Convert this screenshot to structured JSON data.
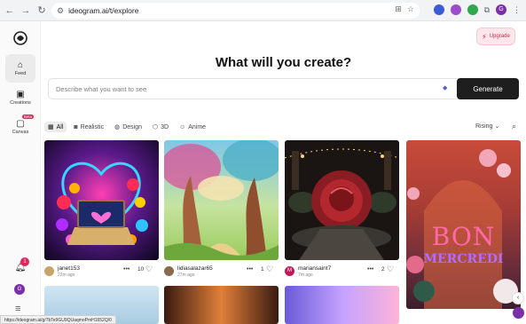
{
  "browser": {
    "url": "ideogram.ai/t/explore",
    "profile_initial": "G"
  },
  "sidebar": {
    "items": [
      {
        "label": "Feed",
        "icon": "home-icon"
      },
      {
        "label": "Creations",
        "icon": "gallery-icon"
      },
      {
        "label": "Canvas",
        "icon": "canvas-icon",
        "badge": "Beta"
      }
    ],
    "notification_count": "1",
    "user_initial": "G"
  },
  "header": {
    "upgrade_label": "Upgrade"
  },
  "main": {
    "headline": "What will you create?",
    "prompt_placeholder": "Describe what you want to see",
    "generate_label": "Generate",
    "filters": [
      {
        "label": "All",
        "icon": "grid-icon"
      },
      {
        "label": "Realistic",
        "icon": "camera-icon"
      },
      {
        "label": "Design",
        "icon": "palette-icon"
      },
      {
        "label": "3D",
        "icon": "cube-icon"
      },
      {
        "label": "Anime",
        "icon": "anime-icon"
      }
    ],
    "sort_label": "Rising"
  },
  "gallery": [
    {
      "user": "janet153",
      "time": "22m ago",
      "likes": "10",
      "avatar_color": "#c9a46a"
    },
    {
      "user": "lidiasalazar65",
      "time": "27m ago",
      "likes": "1",
      "avatar_color": "#8a6a4a"
    },
    {
      "user": "mariansaint7",
      "time": "7m ago",
      "likes": "2",
      "avatar_color": "#c2185b",
      "avatar_initial": "M"
    },
    {
      "user": "",
      "time": "",
      "likes": "",
      "poster_lines": [
        "BON",
        "MERCREDI"
      ]
    }
  ],
  "status_bar": {
    "link_url": "https://ideogram.ai/g/7bTe9GU9QUaqmoPmH1652Q/0"
  },
  "colors": {
    "accent": "#e0245e",
    "generate_bg": "#1e1e1e",
    "brand_purple": "#7a2ea8"
  }
}
